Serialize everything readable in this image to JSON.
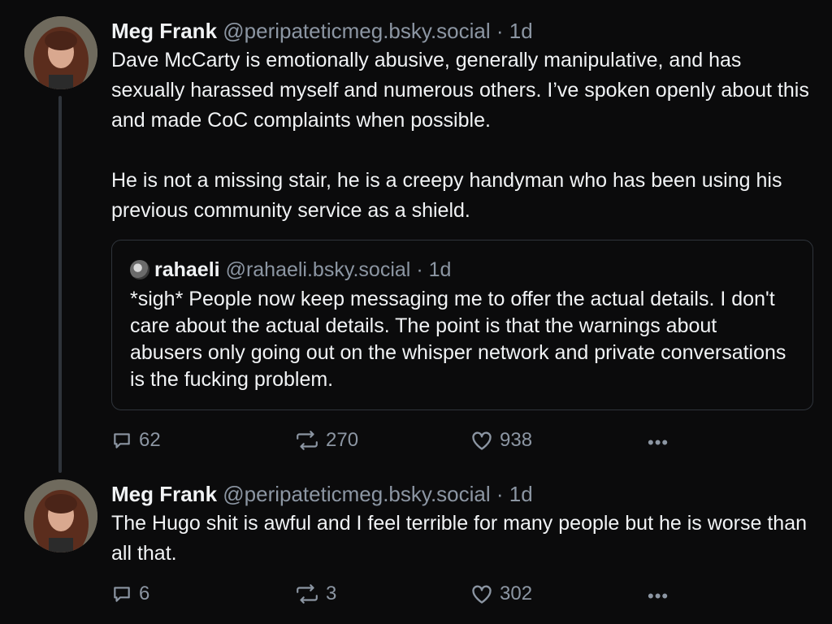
{
  "posts": [
    {
      "author_name": "Meg Frank",
      "author_handle": "@peripateticmeg.bsky.social",
      "separator": "·",
      "time": "1d",
      "text": "Dave McCarty is emotionally abusive, generally manipulative, and has sexually harassed myself and numerous others. I’ve spoken openly about this and made CoC complaints when possible.\n\nHe is not a missing stair, he is a creepy handyman who has been using his previous community service as a shield.",
      "quote": {
        "author_name": "rahaeli",
        "author_handle": "@rahaeli.bsky.social",
        "separator": "·",
        "time": "1d",
        "text": "*sigh* People now keep messaging me to offer the actual details. I don't care about the actual details. The point is that the warnings about abusers only going out on the whisper network and private conversations is the fucking problem."
      },
      "replies": "62",
      "reposts": "270",
      "likes": "938",
      "more": "•••"
    },
    {
      "author_name": "Meg Frank",
      "author_handle": "@peripateticmeg.bsky.social",
      "separator": "·",
      "time": "1d",
      "text": "The Hugo shit is awful and I feel terrible for many people but he is worse than all that.",
      "replies": "6",
      "reposts": "3",
      "likes": "302",
      "more": "•••"
    }
  ],
  "icons": {
    "reply": "reply-icon",
    "repost": "repost-icon",
    "like": "heart-icon",
    "more": "more-options-icon"
  },
  "colors": {
    "background": "#0b0b0c",
    "text": "#f1f3f5",
    "muted": "#8c96a3",
    "border": "#2f343b"
  }
}
